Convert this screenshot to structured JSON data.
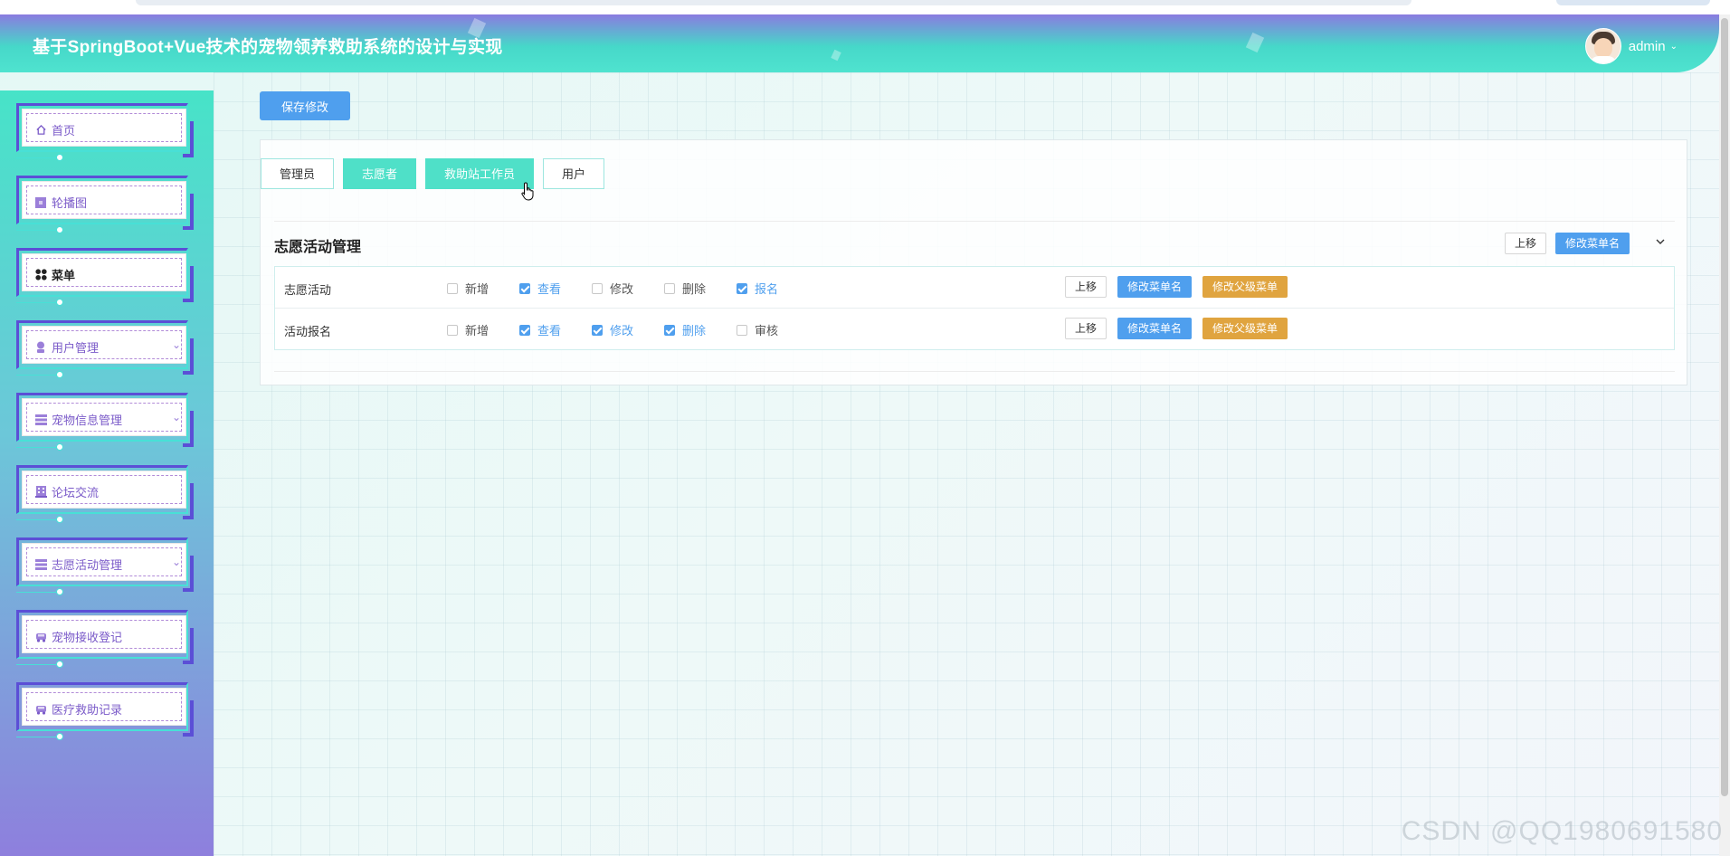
{
  "header": {
    "title": "基于SpringBoot+Vue技术的宠物领养救助系统的设计与实现",
    "username": "admin"
  },
  "sidebar": {
    "items": [
      {
        "label": "首页",
        "icon": "home-icon",
        "has_arrow": false,
        "active": false
      },
      {
        "label": "轮播图",
        "icon": "image-icon",
        "has_arrow": false,
        "active": false
      },
      {
        "label": "菜单",
        "icon": "menu-grid-icon",
        "has_arrow": false,
        "active": true
      },
      {
        "label": "用户管理",
        "icon": "user-icon",
        "has_arrow": true,
        "active": false
      },
      {
        "label": "宠物信息管理",
        "icon": "list-icon",
        "has_arrow": true,
        "active": false
      },
      {
        "label": "论坛交流",
        "icon": "building-icon",
        "has_arrow": false,
        "active": false
      },
      {
        "label": "志愿活动管理",
        "icon": "list-icon",
        "has_arrow": true,
        "active": false
      },
      {
        "label": "宠物接收登记",
        "icon": "car-icon",
        "has_arrow": false,
        "active": false
      },
      {
        "label": "医疗救助记录",
        "icon": "car-icon",
        "has_arrow": false,
        "active": false
      }
    ]
  },
  "toolbar": {
    "save_label": "保存修改"
  },
  "tabs": [
    {
      "label": "管理员",
      "active": false
    },
    {
      "label": "志愿者",
      "active": true
    },
    {
      "label": "救助站工作员",
      "active": true
    },
    {
      "label": "用户",
      "active": false
    }
  ],
  "group": {
    "title": "志愿活动管理",
    "move_up": "上移",
    "rename": "修改菜单名"
  },
  "rows": [
    {
      "name": "志愿活动",
      "perms": [
        {
          "label": "新增",
          "checked": false
        },
        {
          "label": "查看",
          "checked": true
        },
        {
          "label": "修改",
          "checked": false
        },
        {
          "label": "删除",
          "checked": false
        },
        {
          "label": "报名",
          "checked": true
        }
      ],
      "move_up": "上移",
      "rename": "修改菜单名",
      "change_parent": "修改父级菜单"
    },
    {
      "name": "活动报名",
      "perms": [
        {
          "label": "新增",
          "checked": false
        },
        {
          "label": "查看",
          "checked": true
        },
        {
          "label": "修改",
          "checked": true
        },
        {
          "label": "删除",
          "checked": true
        },
        {
          "label": "审核",
          "checked": false
        }
      ],
      "move_up": "上移",
      "rename": "修改菜单名",
      "change_parent": "修改父级菜单"
    }
  ],
  "watermark": "CSDN @QQ1980691580",
  "colors": {
    "accent_blue": "#4f9fee",
    "accent_teal": "#4fe0c8",
    "accent_orange": "#e0a43f",
    "sidebar_purple": "#5b4fd6"
  }
}
